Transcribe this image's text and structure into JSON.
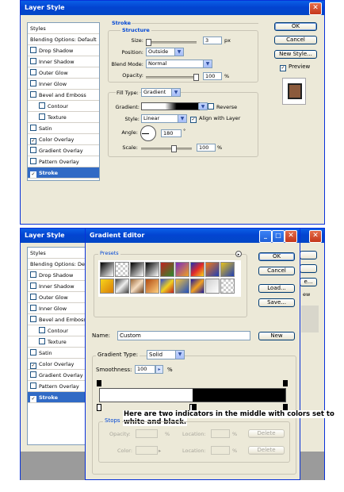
{
  "top_dialog": {
    "title": "Layer Style",
    "close_glyph": "✕",
    "styles_list": [
      {
        "label": "Styles",
        "check": "none"
      },
      {
        "label": "Blending Options: Default",
        "check": "none"
      },
      {
        "label": "Drop Shadow",
        "check": "off"
      },
      {
        "label": "Inner Shadow",
        "check": "off"
      },
      {
        "label": "Outer Glow",
        "check": "off"
      },
      {
        "label": "Inner Glow",
        "check": "off"
      },
      {
        "label": "Bevel and Emboss",
        "check": "off"
      },
      {
        "label": "Contour",
        "check": "off"
      },
      {
        "label": "Texture",
        "check": "off"
      },
      {
        "label": "Satin",
        "check": "off"
      },
      {
        "label": "Color Overlay",
        "check": "on"
      },
      {
        "label": "Gradient Overlay",
        "check": "off"
      },
      {
        "label": "Pattern Overlay",
        "check": "off"
      },
      {
        "label": "Stroke",
        "check": "on",
        "selected": true
      }
    ],
    "buttons": {
      "ok": "OK",
      "cancel": "Cancel",
      "new_style": "New Style...",
      "preview": "Preview"
    },
    "preview_color": "#8b5a3c",
    "stroke": {
      "section_title": "Stroke",
      "structure_title": "Structure",
      "size_label": "Size:",
      "size_value": "3",
      "size_unit": "px",
      "position_label": "Position:",
      "position_value": "Outside",
      "blend_label": "Blend Mode:",
      "blend_value": "Normal",
      "opacity_label": "Opacity:",
      "opacity_value": "100",
      "opacity_unit": "%",
      "fill_type_label": "Fill Type:",
      "fill_type_value": "Gradient",
      "gradient_label": "Gradient:",
      "reverse_label": "Reverse",
      "style_label": "Style:",
      "style_value": "Linear",
      "align_label": "Align with Layer",
      "angle_label": "Angle:",
      "angle_value": "180",
      "angle_unit": "°",
      "scale_label": "Scale:",
      "scale_value": "100",
      "scale_unit": "%"
    }
  },
  "bottom_dialog": {
    "title": "Layer Style",
    "preview_label": "ew",
    "stroke_partial": "e..."
  },
  "gradient_editor": {
    "title": "Gradient Editor",
    "presets_label": "Presets",
    "buttons": {
      "ok": "OK",
      "cancel": "Cancel",
      "load": "Load...",
      "save": "Save...",
      "new": "New",
      "delete": "Delete"
    },
    "name_label": "Name:",
    "name_value": "Custom",
    "type_label": "Gradient Type:",
    "type_value": "Solid",
    "smoothness_label": "Smoothness:",
    "smoothness_value": "100",
    "smoothness_unit": "%",
    "stops_label": "Stops",
    "opacity_label": "Opacity:",
    "opacity_unit": "%",
    "location_label": "Location:",
    "location_unit": "%",
    "color_label": "Color:",
    "annotation_line1": "Here are two indicators in the middle with colors set to",
    "annotation_line2": "white and black.",
    "colors": {
      "title_blue": "#0a5fe6",
      "selection": "#316ac5",
      "accent_label": "#0046d5"
    }
  }
}
